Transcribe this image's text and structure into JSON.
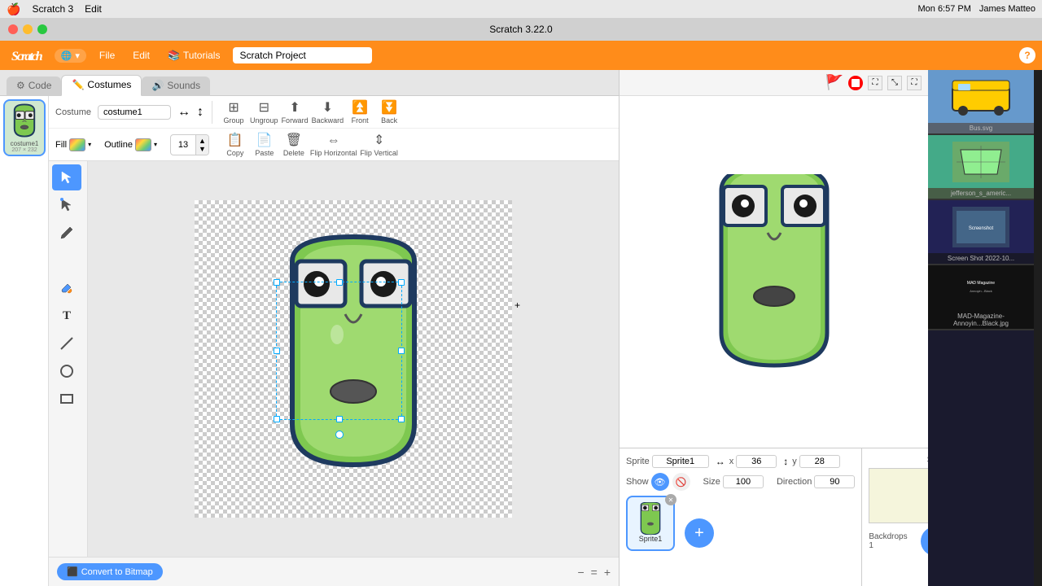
{
  "menubar": {
    "apple": "🍎",
    "app_name": "Scratch 3",
    "edit_menu": "Edit",
    "time": "Mon 6:57 PM",
    "user": "James Matteo",
    "title": "Scratch 3.22.0"
  },
  "header": {
    "logo_text": "Scratch",
    "file_label": "File",
    "edit_label": "Edit",
    "tutorials_label": "Tutorials",
    "project_name": "Scratch Project",
    "help_label": "?"
  },
  "editor": {
    "tabs": {
      "code_label": "Code",
      "costumes_label": "Costumes",
      "sounds_label": "Sounds"
    },
    "toolbar": {
      "costume_label": "Costume",
      "costume_name": "costume1",
      "group_label": "Group",
      "ungroup_label": "Ungroup",
      "forward_label": "Forward",
      "backward_label": "Backward",
      "front_label": "Front",
      "back_label": "Back",
      "copy_label": "Copy",
      "paste_label": "Paste",
      "delete_label": "Delete",
      "flip_h_label": "Flip Horizontal",
      "flip_v_label": "Flip Vertical",
      "fill_label": "Fill",
      "outline_label": "Outline",
      "thickness_value": "13"
    },
    "canvas": {
      "convert_btn": "Convert to Bitmap"
    }
  },
  "stage": {
    "sprite_label": "Sprite",
    "sprite_name": "Sprite1",
    "x_label": "x",
    "x_value": "36",
    "y_label": "y",
    "y_value": "28",
    "show_label": "Show",
    "size_label": "Size",
    "size_value": "100",
    "direction_label": "Direction",
    "direction_value": "90",
    "backdrops_label": "Backdrops",
    "backdrops_count": "1",
    "stage_label": "Stage"
  },
  "costumes": {
    "list": [
      {
        "name": "costume1",
        "size": "207 × 232"
      }
    ]
  },
  "sprites": [
    {
      "name": "Sprite1",
      "has_delete": true
    }
  ],
  "zoom": {
    "zoom_out": "−",
    "zoom_reset": "=",
    "zoom_in": "+"
  }
}
